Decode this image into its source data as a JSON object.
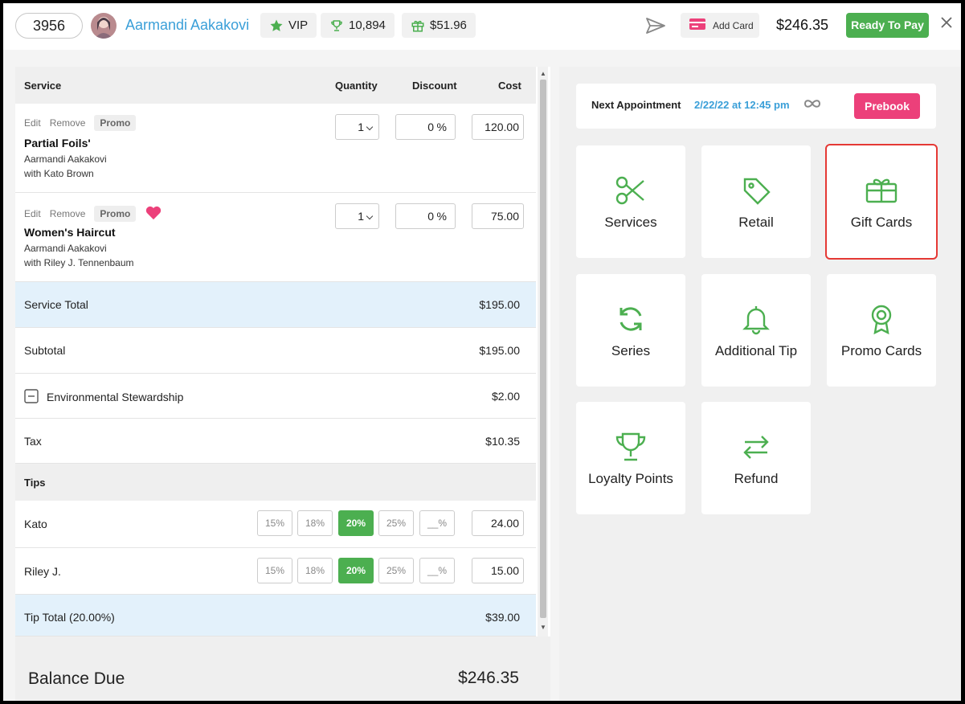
{
  "header": {
    "ticket_number": "3956",
    "client_name": "Aarmandi Aakakovi",
    "vip_label": "VIP",
    "loyalty_points": "10,894",
    "gift_balance": "$51.96",
    "add_card_label": "Add Card",
    "total": "$246.35",
    "ready_label": "Ready To Pay"
  },
  "table": {
    "headers": {
      "service": "Service",
      "quantity": "Quantity",
      "discount": "Discount",
      "cost": "Cost"
    },
    "services": [
      {
        "edit": "Edit",
        "remove": "Remove",
        "promo": "Promo",
        "name": "Partial Foils'",
        "client": "Aarmandi Aakakovi",
        "staff": "with Kato Brown",
        "qty": "1",
        "discount": "0",
        "discount_unit": "%",
        "cost": "120.00"
      },
      {
        "edit": "Edit",
        "remove": "Remove",
        "promo": "Promo",
        "name": "Women's Haircut",
        "client": "Aarmandi Aakakovi",
        "staff": "with Riley J. Tennenbaum",
        "qty": "1",
        "discount": "0",
        "discount_unit": "%",
        "cost": "75.00"
      }
    ]
  },
  "summary": {
    "service_total_label": "Service Total",
    "service_total": "$195.00",
    "subtotal_label": "Subtotal",
    "subtotal": "$195.00",
    "env_label": "Environmental Stewardship",
    "env": "$2.00",
    "tax_label": "Tax",
    "tax": "$10.35"
  },
  "tips": {
    "header": "Tips",
    "options": [
      "15%",
      "18%",
      "20%",
      "25%",
      "__%"
    ],
    "rows": [
      {
        "name": "Kato",
        "amount": "24.00"
      },
      {
        "name": "Riley J.",
        "amount": "15.00"
      }
    ],
    "total_label": "Tip Total (20.00%)",
    "total": "$39.00"
  },
  "balance": {
    "label": "Balance Due",
    "value": "$246.35"
  },
  "appointment": {
    "label": "Next Appointment",
    "date": "2/22/22 at 12:45 pm",
    "prebook_label": "Prebook"
  },
  "tiles": {
    "services": "Services",
    "retail": "Retail",
    "gift_cards": "Gift Cards",
    "series": "Series",
    "additional_tip": "Additional Tip",
    "promo_cards": "Promo Cards",
    "loyalty_points": "Loyalty Points",
    "refund": "Refund"
  },
  "colors": {
    "green": "#4caf50",
    "blue_link": "#3a9fd8",
    "pink": "#ec407a",
    "selection": "#e53935"
  }
}
